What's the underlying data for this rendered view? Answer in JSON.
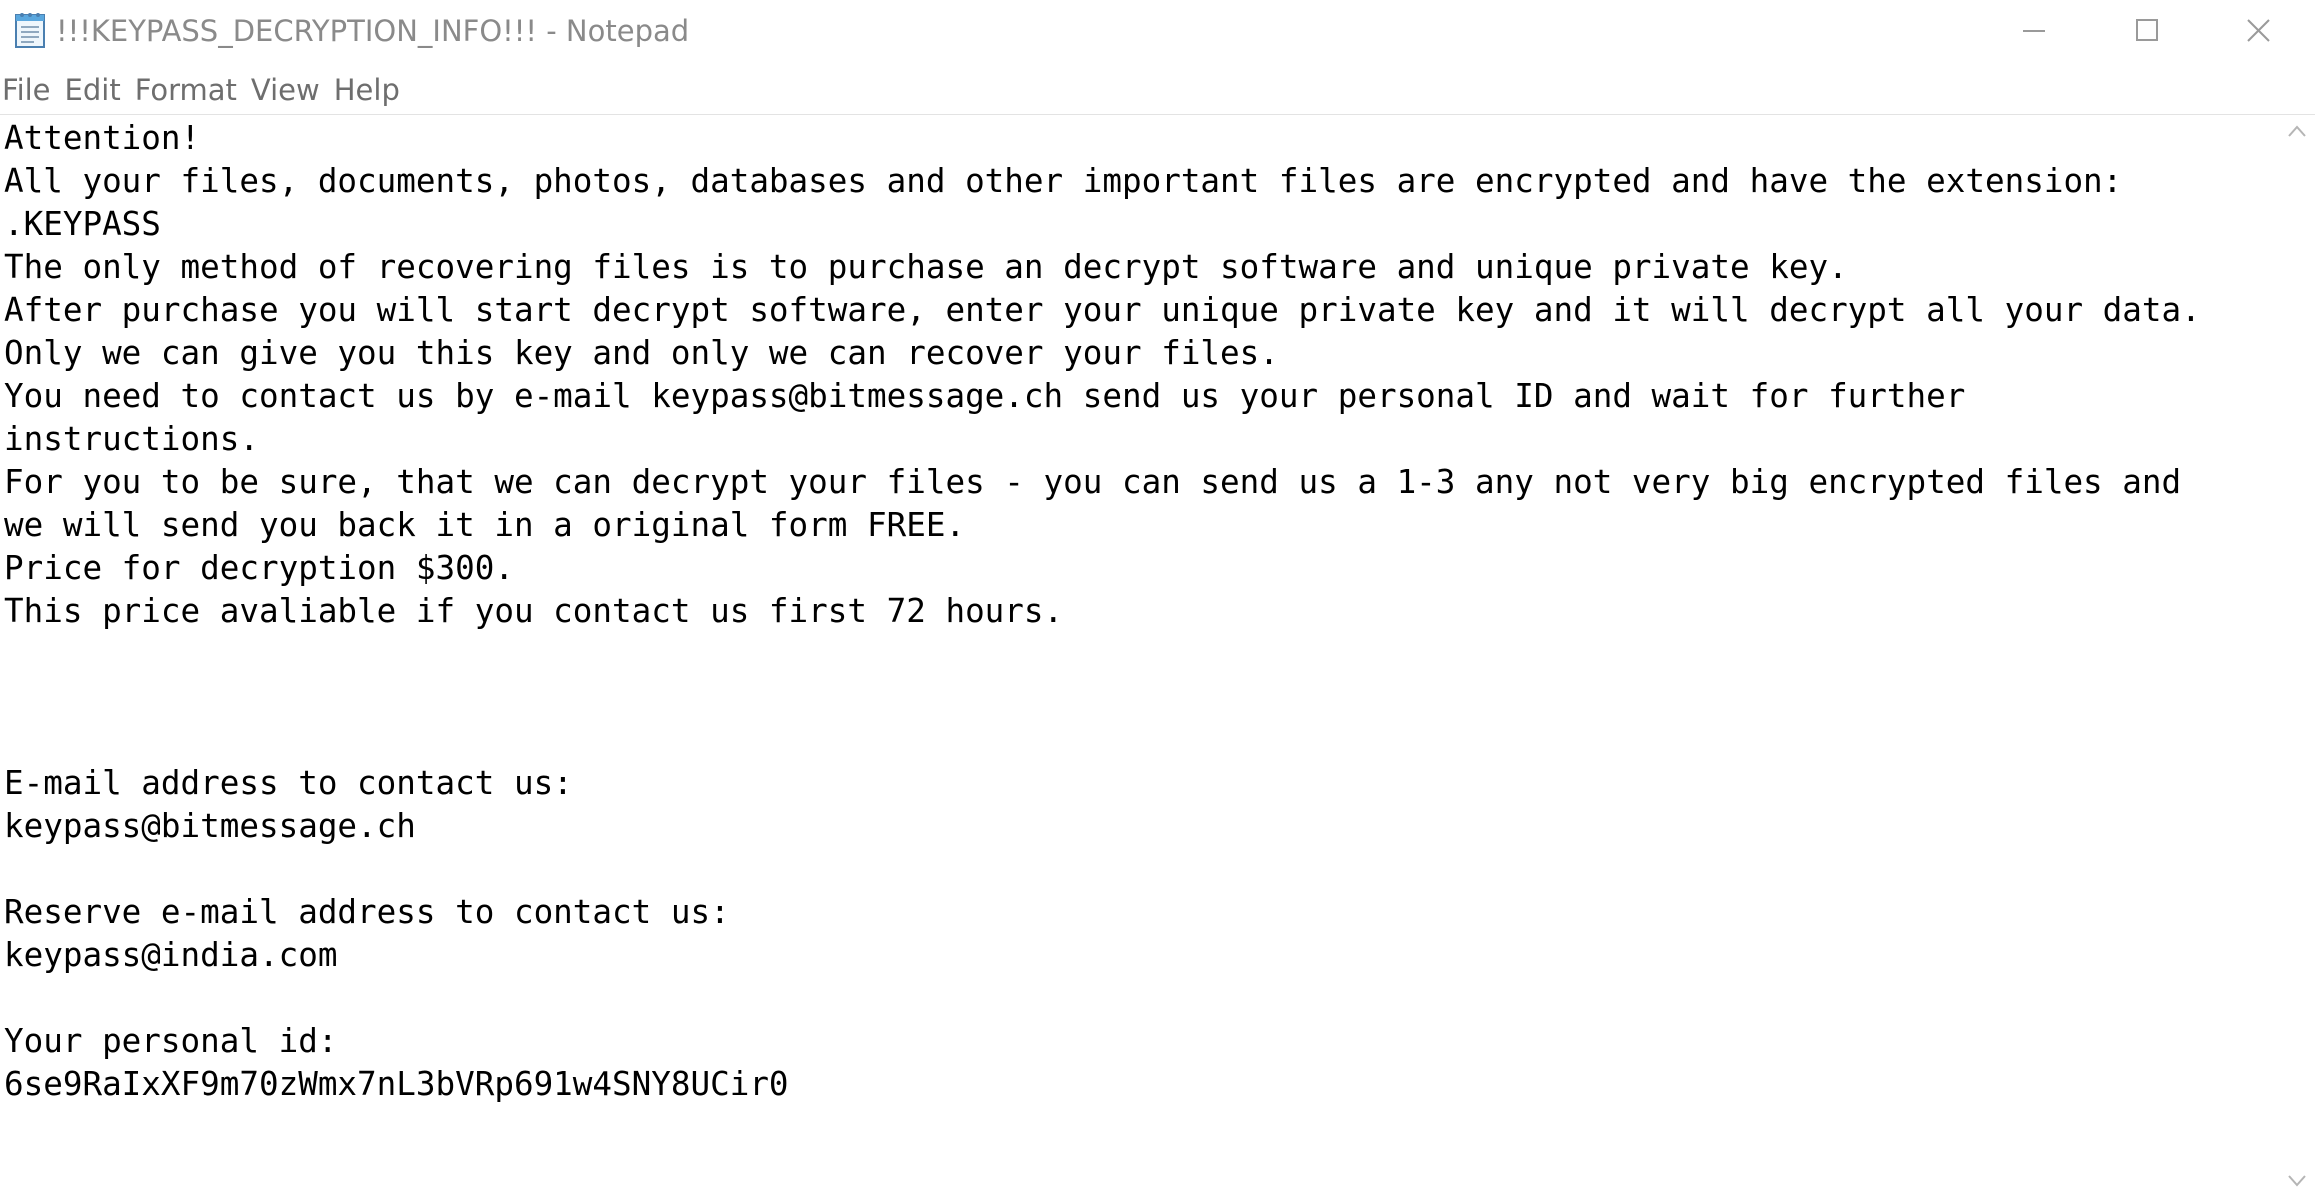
{
  "window": {
    "title": "!!!KEYPASS_DECRYPTION_INFO!!! - Notepad",
    "app_icon": "notepad-icon"
  },
  "controls": {
    "minimize_icon": "minimize-icon",
    "maximize_icon": "maximize-icon",
    "close_icon": "close-icon"
  },
  "menu": {
    "file": "File",
    "edit": "Edit",
    "format": "Format",
    "view": "View",
    "help": "Help"
  },
  "document": {
    "lines": [
      "Attention!",
      "All your files, documents, photos, databases and other important files are encrypted and have the extension:",
      ".KEYPASS",
      "The only method of recovering files is to purchase an decrypt software and unique private key.",
      "After purchase you will start decrypt software, enter your unique private key and it will decrypt all your data.",
      "Only we can give you this key and only we can recover your files.",
      "You need to contact us by e-mail keypass@bitmessage.ch send us your personal ID and wait for further",
      "instructions.",
      "For you to be sure, that we can decrypt your files - you can send us a 1-3 any not very big encrypted files and",
      "we will send you back it in a original form FREE.",
      "Price for decryption $300.",
      "This price avaliable if you contact us first 72 hours.",
      "",
      "",
      "",
      "E-mail address to contact us:",
      "keypass@bitmessage.ch",
      "",
      "Reserve e-mail address to contact us:",
      "keypass@india.com",
      "",
      "Your personal id:",
      "6se9RaIxXF9m70zWmx7nL3bVRp691w4SNY8UCir0"
    ]
  },
  "scrollbar": {
    "up_icon": "scroll-up-arrow-icon",
    "down_icon": "scroll-down-arrow-icon"
  }
}
